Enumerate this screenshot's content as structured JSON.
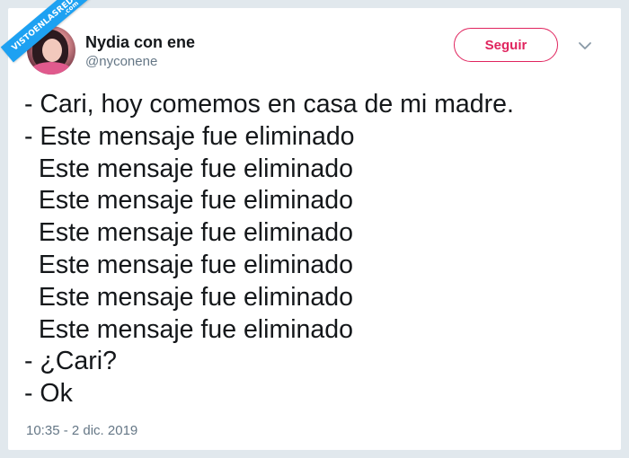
{
  "watermark": {
    "text": "VISTOENLASREDES",
    "suffix": ".com"
  },
  "author": {
    "name": "Nydia con ene",
    "handle": "@nyconene"
  },
  "follow_button": {
    "label": "Seguir"
  },
  "tweet": {
    "lines": [
      "- Cari, hoy comemos en casa de mi madre.",
      "- Este mensaje fue eliminado",
      "  Este mensaje fue eliminado",
      "  Este mensaje fue eliminado",
      "  Este mensaje fue eliminado",
      "  Este mensaje fue eliminado",
      "  Este mensaje fue eliminado",
      "  Este mensaje fue eliminado",
      "- ¿Cari?",
      "- Ok"
    ],
    "timestamp": "10:35 - 2 dic. 2019"
  },
  "icons": {
    "menu": "chevron-down-icon"
  },
  "colors": {
    "follow_accent": "#e0245e",
    "watermark_bg": "#1da1f2",
    "muted_text": "#657786",
    "main_text": "#14171a"
  }
}
